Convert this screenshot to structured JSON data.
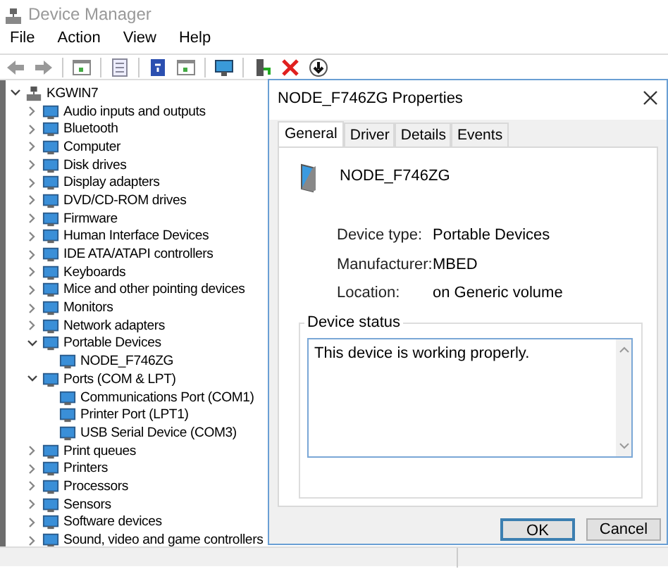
{
  "window": {
    "title": "Device Manager"
  },
  "menu": [
    "File",
    "Action",
    "View",
    "Help"
  ],
  "tree": {
    "label": "KGWIN7",
    "expanded": true,
    "children": [
      {
        "label": "Audio inputs and outputs",
        "expanded": false
      },
      {
        "label": "Bluetooth",
        "expanded": false
      },
      {
        "label": "Computer",
        "expanded": false
      },
      {
        "label": "Disk drives",
        "expanded": false
      },
      {
        "label": "Display adapters",
        "expanded": false
      },
      {
        "label": "DVD/CD-ROM drives",
        "expanded": false
      },
      {
        "label": "Firmware",
        "expanded": false
      },
      {
        "label": "Human Interface Devices",
        "expanded": false
      },
      {
        "label": "IDE ATA/ATAPI controllers",
        "expanded": false
      },
      {
        "label": "Keyboards",
        "expanded": false
      },
      {
        "label": "Mice and other pointing devices",
        "expanded": false
      },
      {
        "label": "Monitors",
        "expanded": false
      },
      {
        "label": "Network adapters",
        "expanded": false
      },
      {
        "label": "Portable Devices",
        "expanded": true,
        "children": [
          {
            "label": "NODE_F746ZG"
          }
        ]
      },
      {
        "label": "Ports (COM & LPT)",
        "expanded": true,
        "children": [
          {
            "label": "Communications Port (COM1)"
          },
          {
            "label": "Printer Port (LPT1)"
          },
          {
            "label": "USB Serial Device (COM3)"
          }
        ]
      },
      {
        "label": "Print queues",
        "expanded": false
      },
      {
        "label": "Printers",
        "expanded": false
      },
      {
        "label": "Processors",
        "expanded": false
      },
      {
        "label": "Sensors",
        "expanded": false
      },
      {
        "label": "Software devices",
        "expanded": false
      },
      {
        "label": "Sound, video and game controllers",
        "expanded": false
      }
    ]
  },
  "dialog": {
    "title": "NODE_F746ZG Properties",
    "tabs": [
      {
        "label": "General",
        "selected": true
      },
      {
        "label": "Driver",
        "selected": false
      },
      {
        "label": "Details",
        "selected": false
      },
      {
        "label": "Events",
        "selected": false
      }
    ],
    "device_name": "NODE_F746ZG",
    "properties": [
      {
        "label": "Device type:",
        "value": "Portable Devices"
      },
      {
        "label": "Manufacturer:",
        "value": "MBED"
      },
      {
        "label": "Location:",
        "value": "on Generic volume"
      }
    ],
    "status_group": "Device status",
    "status_text": "This device is working properly.",
    "buttons": [
      {
        "label": "OK",
        "default": true
      },
      {
        "label": "Cancel",
        "default": false
      }
    ]
  }
}
